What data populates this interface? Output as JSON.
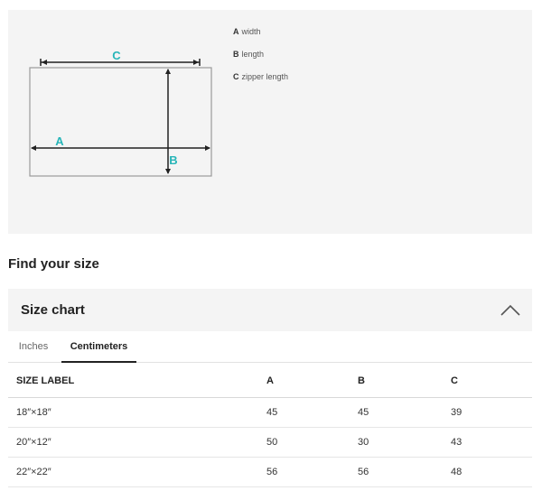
{
  "diagram": {
    "labels": {
      "a": "A",
      "b": "B",
      "c": "C"
    },
    "accent_color": "#27b5b8",
    "legend": [
      {
        "key": "A",
        "text": "width"
      },
      {
        "key": "B",
        "text": "length"
      },
      {
        "key": "C",
        "text": "zipper length"
      }
    ]
  },
  "find_size": {
    "title": "Find your size"
  },
  "size_chart": {
    "title": "Size chart",
    "toggle_icon": "chevron-up-icon",
    "tabs": [
      {
        "label": "Inches",
        "active": false
      },
      {
        "label": "Centimeters",
        "active": true
      }
    ],
    "table": {
      "headers": [
        "SIZE LABEL",
        "A",
        "B",
        "C"
      ],
      "rows": [
        [
          "18″×18″",
          "45",
          "45",
          "39"
        ],
        [
          "20″×12″",
          "50",
          "30",
          "43"
        ],
        [
          "22″×22″",
          "56",
          "56",
          "48"
        ]
      ]
    }
  }
}
